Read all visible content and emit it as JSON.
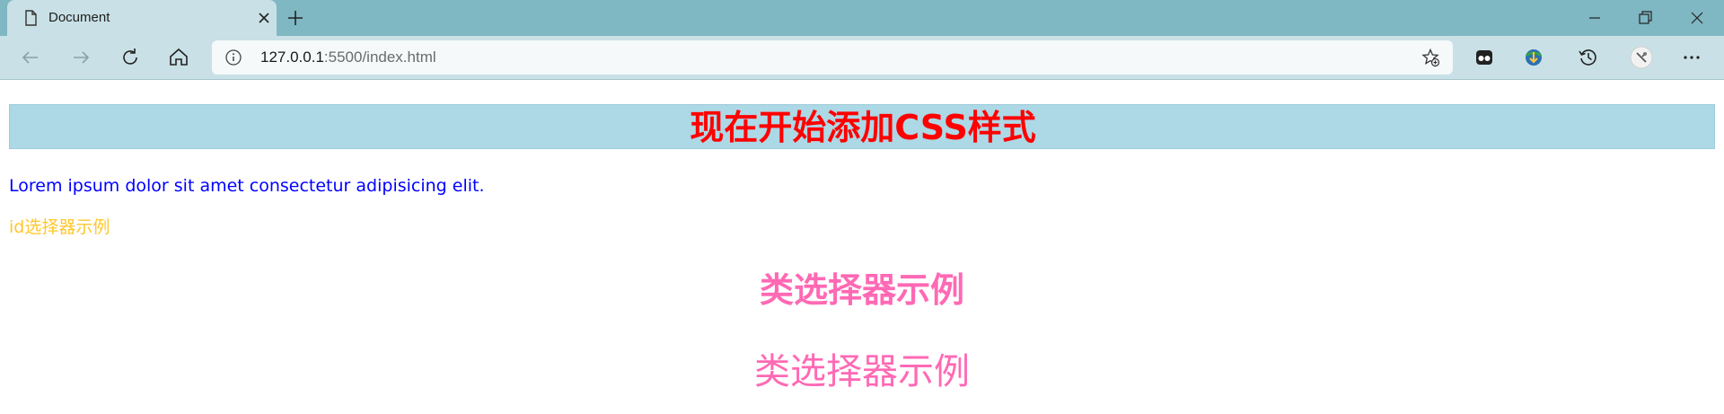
{
  "browser": {
    "tab": {
      "title": "Document",
      "icon": "document-icon",
      "close_icon": "close-icon"
    },
    "new_tab_icon": "plus-icon",
    "window_controls": [
      "minimize-icon",
      "restore-icon",
      "close-icon"
    ],
    "toolbar": {
      "nav_icons": [
        "back-arrow-icon",
        "forward-arrow-icon",
        "refresh-icon",
        "home-icon"
      ],
      "address": {
        "host": "127.0.0.1",
        "path": ":5500/index.html",
        "info_icon": "info-icon",
        "favorite_icon": "add-favorite-icon"
      },
      "extension_icons": [
        "extension-icon",
        "download-manager-icon",
        "history-icon",
        "profile-avatar-icon",
        "more-options-icon"
      ]
    },
    "colors": {
      "tabstrip_bg": "#7fb7c3",
      "toolbar_bg": "#c9e1e6"
    }
  },
  "page": {
    "heading": "现在开始添加CSS样式",
    "paragraph": "Lorem ipsum dolor sit amet consectetur adipisicing elit.",
    "id_selector_text": "id选择器示例",
    "class_heading": "类选择器示例",
    "class_paragraph": "类选择器示例",
    "colors": {
      "heading_bg": "#add8e6",
      "heading_text": "#ff0000",
      "paragraph_text": "#0000ff",
      "id_text": "#ffc72c",
      "class_text": "#ff69b4"
    }
  }
}
